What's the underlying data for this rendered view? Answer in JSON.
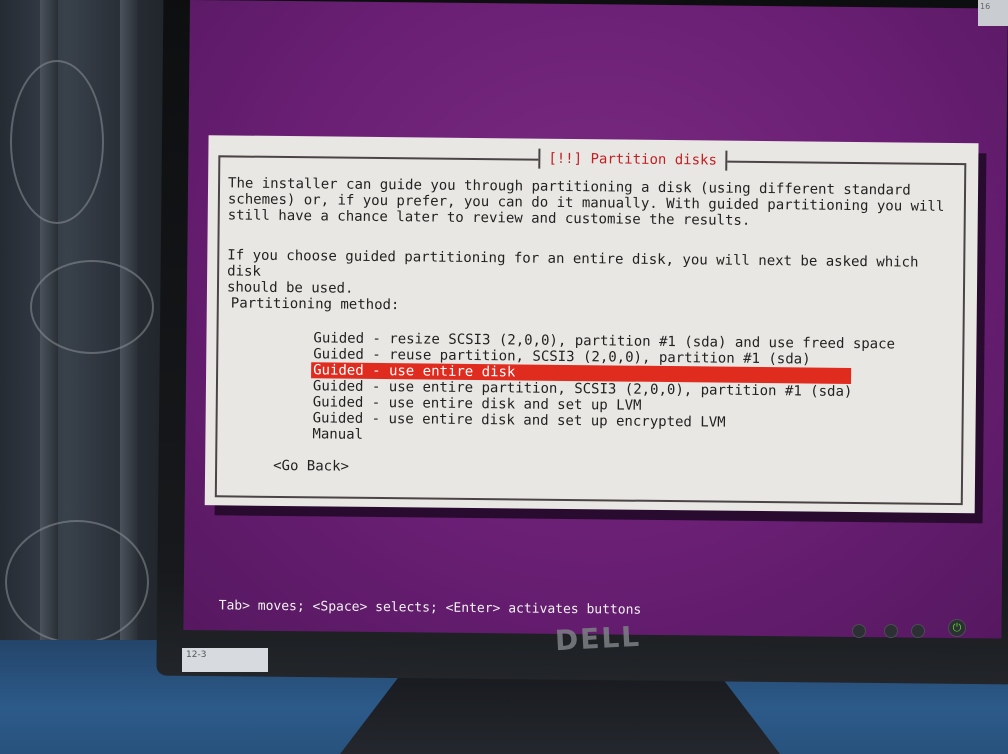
{
  "dialog": {
    "title": "[!!] Partition disks",
    "intro": "The installer can guide you through partitioning a disk (using different standard\nschemes) or, if you prefer, you can do it manually. With guided partitioning you will\nstill have a chance later to review and customise the results.",
    "intro2": "If you choose guided partitioning for an entire disk, you will next be asked which disk\nshould be used.",
    "method_label": "Partitioning method:",
    "options": [
      "Guided - resize SCSI3 (2,0,0), partition #1 (sda) and use freed space",
      "Guided - reuse partition, SCSI3 (2,0,0), partition #1 (sda)",
      "Guided - use entire disk",
      "Guided - use entire partition, SCSI3 (2,0,0), partition #1 (sda)",
      "Guided - use entire disk and set up LVM",
      "Guided - use entire disk and set up encrypted LVM",
      "Manual"
    ],
    "selected_index": 2,
    "go_back_label": "<Go Back>"
  },
  "status_bar": "Tab> moves; <Space> selects; <Enter> activates buttons",
  "monitor": {
    "brand": "DELL",
    "asset_tag": "12-3",
    "corner_tag": "16"
  },
  "colors": {
    "screen_background": "#6a1f74",
    "dialog_background": "#e9e7e3",
    "selection": "#e02b1f",
    "title_text": "#c21f22"
  }
}
